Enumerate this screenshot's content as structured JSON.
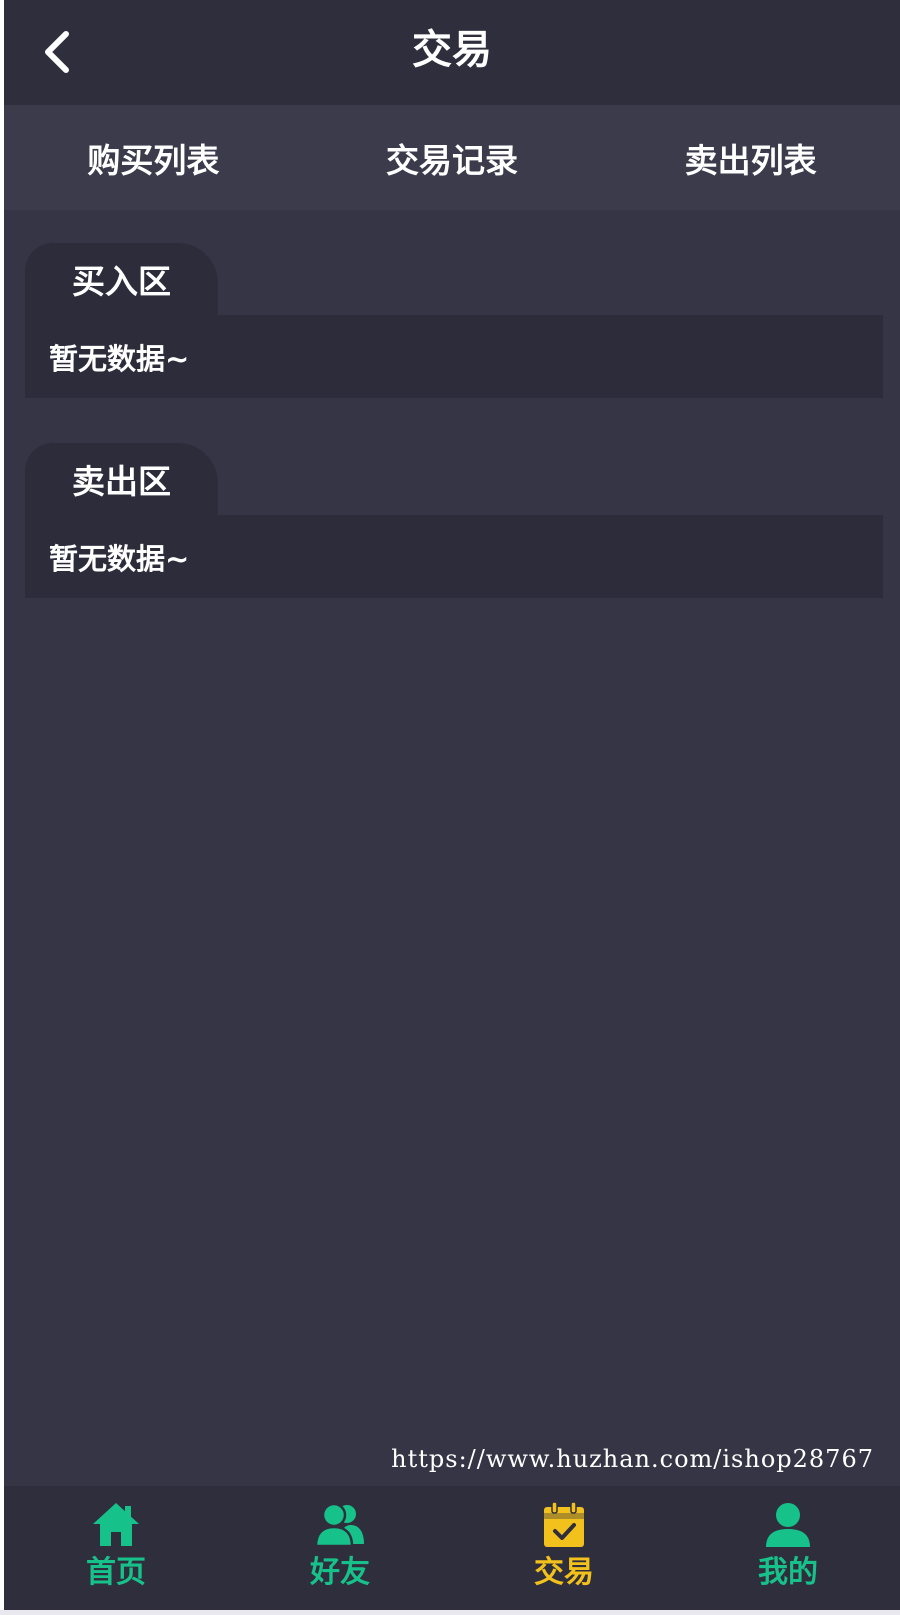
{
  "header": {
    "title": "交易",
    "back_icon": "chevron-left-icon"
  },
  "tabs": [
    {
      "label": "购买列表"
    },
    {
      "label": "交易记录"
    },
    {
      "label": "卖出列表"
    }
  ],
  "zones": [
    {
      "title": "买入区",
      "empty_text": "暂无数据~"
    },
    {
      "title": "卖出区",
      "empty_text": "暂无数据~"
    }
  ],
  "watermark": "https://www.huzhan.com/ishop28767",
  "bottom_nav": {
    "items": [
      {
        "label": "首页",
        "icon": "home-icon",
        "active": false
      },
      {
        "label": "好友",
        "icon": "friends-icon",
        "active": false
      },
      {
        "label": "交易",
        "icon": "calendar-check-icon",
        "active": true
      },
      {
        "label": "我的",
        "icon": "user-icon",
        "active": false
      }
    ]
  },
  "colors": {
    "background": "#363545",
    "header_bg": "#2f2e3d",
    "tabs_bg": "#3c3b4c",
    "panel_bg": "#2d2c3b",
    "nav_default": "#17c28a",
    "nav_active": "#f2c11c",
    "text": "#ffffff"
  }
}
